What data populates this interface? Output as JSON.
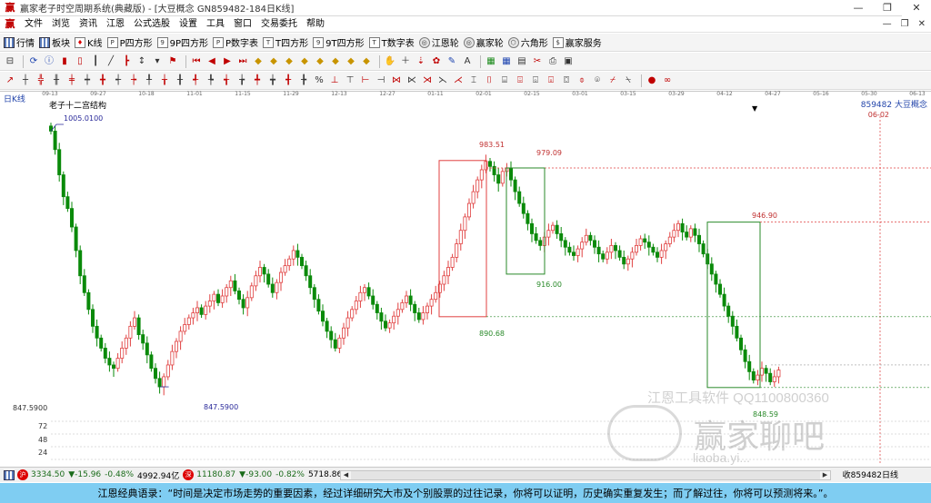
{
  "window": {
    "title": "赢家老子时空周期系统(典藏版) - [大豆概念  GN859482-184日K线]",
    "minimize": "—",
    "maximize": "❐",
    "close": "✕"
  },
  "menu": {
    "items": [
      "文件",
      "浏览",
      "资讯",
      "江恩",
      "公式选股",
      "设置",
      "工具",
      "窗口",
      "交易委托",
      "帮助"
    ],
    "right_controls": [
      "—",
      "❐",
      "✕"
    ]
  },
  "toolbar1": [
    {
      "label": "行情",
      "icon": "quote-grid-icon"
    },
    {
      "label": "板块",
      "icon": "sector-icon"
    },
    {
      "label": "K线",
      "icon": "kline-icon"
    },
    {
      "label": "P四方形",
      "icon": "p-square-icon"
    },
    {
      "label": "9P四方形",
      "icon": "9p-square-icon"
    },
    {
      "label": "P数字表",
      "icon": "p-number-table-icon"
    },
    {
      "label": "T四方形",
      "icon": "t-square-icon"
    },
    {
      "label": "9T四方形",
      "icon": "9t-square-icon"
    },
    {
      "label": "T数字表",
      "icon": "t-number-table-icon"
    },
    {
      "label": "江恩轮",
      "icon": "gann-wheel-icon"
    },
    {
      "label": "赢家轮",
      "icon": "winner-wheel-icon"
    },
    {
      "label": "六角形",
      "icon": "hexagon-icon"
    },
    {
      "label": "赢家服务",
      "icon": "service-icon"
    }
  ],
  "status": {
    "index1_value": "3334.50",
    "index1_change": "▼-15.96",
    "index1_pct": "-0.48%",
    "index1_amount": "4992.94亿",
    "index2_value": "11180.87",
    "index2_change": "▼-93.00",
    "index2_pct": "-0.82%",
    "index2_amount": "5718.86",
    "right_text": "收859482日线"
  },
  "quote": {
    "text": "江恩经典语录：“时间是决定市场走势的重要因素，经过详细研究大市及个别股票的过往记录，你将可以证明，历史确实重复发生；而了解过往，你将可以预测将来。”。"
  },
  "chart_overlay": {
    "period": "日K线",
    "title": "老子十二宫结构",
    "high_label": "1005.0100",
    "low_label": "847.5900",
    "left_axis_price": "847.5900",
    "right_code": "859482",
    "right_name": "大豆概念",
    "right_date": "06-02",
    "dropdown": "▼",
    "levels": {
      "a": "983.51",
      "b": "979.09",
      "c": "946.90",
      "d": "916.00",
      "e": "890.68",
      "f": "848.59"
    },
    "volume_ticks": [
      "72",
      "48",
      "24"
    ],
    "watermark_line1": "江恩工具软件 QQ1100800360",
    "watermark_line2": "赢家聊吧",
    "watermark_line3": "liaoba.yi..."
  },
  "chart_data": {
    "type": "candlestick",
    "title": "老子十二宫结构",
    "x_ticks": [
      "09-13",
      "09-27",
      "10-18",
      "11-01",
      "11-15",
      "11-29",
      "12-13",
      "12-27",
      "01-11",
      "02-01",
      "02-15",
      "03-01",
      "03-15",
      "03-29",
      "04-12",
      "04-27",
      "05-16",
      "05-30",
      "06-13"
    ],
    "ylim": [
      835,
      1012
    ],
    "closes": [
      1001,
      990,
      975,
      962,
      955,
      944,
      930,
      915,
      905,
      895,
      885,
      878,
      872,
      866,
      862,
      860,
      866,
      872,
      878,
      885,
      890,
      880,
      875,
      868,
      860,
      854,
      849,
      855,
      862,
      870,
      876,
      882,
      886,
      890,
      893,
      896,
      892,
      897,
      900,
      904,
      899,
      903,
      908,
      912,
      906,
      901,
      896,
      902,
      909,
      915,
      920,
      916,
      910,
      905,
      911,
      917,
      921,
      925,
      930,
      926,
      921,
      915,
      908,
      901,
      894,
      888,
      882,
      877,
      872,
      878,
      884,
      890,
      895,
      900,
      905,
      908,
      903,
      898,
      893,
      888,
      884,
      887,
      891,
      895,
      899,
      903,
      898,
      893,
      889,
      893,
      897,
      901,
      905,
      910,
      915,
      920,
      926,
      934,
      942,
      950,
      958,
      965,
      972,
      978,
      983,
      980,
      975,
      970,
      977,
      979,
      972,
      965,
      958,
      952,
      946,
      940,
      936,
      933,
      938,
      942,
      945,
      940,
      936,
      932,
      929,
      927,
      931,
      935,
      939,
      936,
      932,
      928,
      925,
      929,
      933,
      930,
      926,
      922,
      925,
      929,
      933,
      937,
      935,
      932,
      929,
      926,
      930,
      934,
      938,
      942,
      946,
      941,
      938,
      943,
      939,
      934,
      928,
      922,
      916,
      910,
      904,
      897,
      891,
      885,
      878,
      871,
      864,
      858,
      853,
      856,
      860,
      857,
      852,
      855,
      859
    ]
  }
}
